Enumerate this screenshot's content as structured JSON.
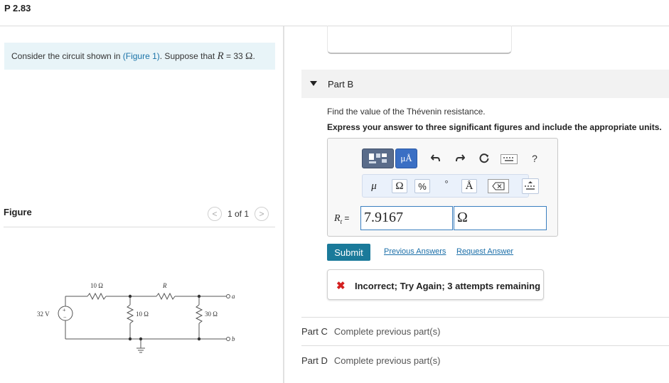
{
  "problem_id": "P 2.83",
  "intro": {
    "prefix": "Consider the circuit shown in ",
    "figure_link": "(Figure 1)",
    "middle": ". Suppose that ",
    "var": "R",
    "equals": " = 33 ",
    "unit": "Ω",
    "end": "."
  },
  "figure_panel": {
    "label": "Figure",
    "counter": "1 of 1",
    "prev_glyph": "<",
    "next_glyph": ">"
  },
  "circuit": {
    "source": "32 V",
    "r_series_top": "10 Ω",
    "r_variable": "R",
    "r_shunt_1": "10 Ω",
    "r_shunt_2": "30 Ω",
    "terminal_a": "a",
    "terminal_b": "b",
    "plus": "+",
    "minus": "−"
  },
  "part_b": {
    "title": "Part B",
    "question": "Find the value of the Thévenin resistance.",
    "instruction": "Express your answer to three significant figures and include the appropriate units.",
    "toolbar": {
      "units_label": "μÅ",
      "help": "?"
    },
    "symbols": [
      "μ",
      "Ω",
      "%",
      "°",
      "Å"
    ],
    "answer_label_var": "R",
    "answer_label_sub": "t",
    "answer_label_eq": " = ",
    "answer_value": "7.9167",
    "answer_unit": "Ω",
    "submit": "Submit",
    "previous_answers": "Previous Answers",
    "request_answer": "Request Answer",
    "feedback": "Incorrect; Try Again; 3 attempts remaining",
    "feedback_icon": "✖"
  },
  "parts": [
    {
      "name": "Part C",
      "status": "Complete previous part(s)"
    },
    {
      "name": "Part D",
      "status": "Complete previous part(s)"
    }
  ],
  "colors": {
    "accent": "#1a7a9a",
    "link": "#1a6ea8",
    "intro_bg": "#e8f4f8",
    "error": "#d42020"
  }
}
